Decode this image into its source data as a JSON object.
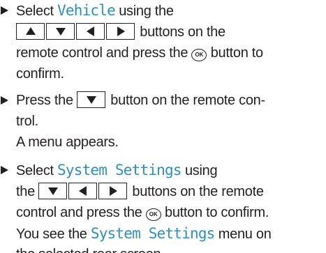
{
  "steps": [
    {
      "lines": [
        {
          "pre": "Select ",
          "term": "Vehicle",
          "post": " using the"
        },
        {
          "post": " buttons on the"
        },
        {
          "text": "remote control and press the",
          "ok": "OK",
          "post": " button to"
        },
        {
          "text": "confirm."
        }
      ]
    },
    {
      "lines": [
        {
          "pre": "Press the ",
          "post": " button on the remote con-"
        },
        {
          "text": "trol."
        },
        {
          "text": "A menu appears."
        }
      ]
    },
    {
      "lines": [
        {
          "pre": "Select ",
          "term": "System Settings",
          "post": " using"
        },
        {
          "pre": "the ",
          "post": " buttons on the remote"
        },
        {
          "text": "control and press the",
          "ok": "OK",
          "post": " button to confirm."
        },
        {
          "text": "You see the ",
          "term": "System Settings",
          "post": " menu on"
        },
        {
          "text": "the selected rear screen."
        }
      ]
    }
  ],
  "colors": {
    "text": "#231f20",
    "menu_term": "#2b8fc0"
  },
  "icons": {
    "bullet": "right-triangle-arrow",
    "keys": [
      "up-arrow-key",
      "down-arrow-key",
      "left-arrow-key",
      "right-arrow-key"
    ],
    "ok": "ok-button-circle"
  }
}
